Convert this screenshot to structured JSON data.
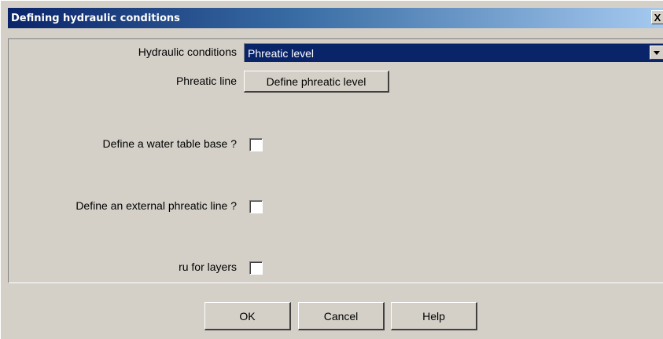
{
  "window": {
    "title": "Defining hydraulic conditions",
    "close_label": "X"
  },
  "form": {
    "hydraulic_conditions_label": "Hydraulic conditions",
    "hydraulic_conditions_value": "Phreatic level",
    "phreatic_line_label": "Phreatic line",
    "define_phreatic_level_button": "Define phreatic level",
    "water_table_base_label": "Define a water table base ?",
    "water_table_base_checked": false,
    "external_phreatic_label": "Define an external phreatic line ?",
    "external_phreatic_checked": false,
    "ru_layers_label": "ru for layers",
    "ru_layers_checked": false
  },
  "footer": {
    "ok_label": "OK",
    "cancel_label": "Cancel",
    "help_label": "Help"
  }
}
